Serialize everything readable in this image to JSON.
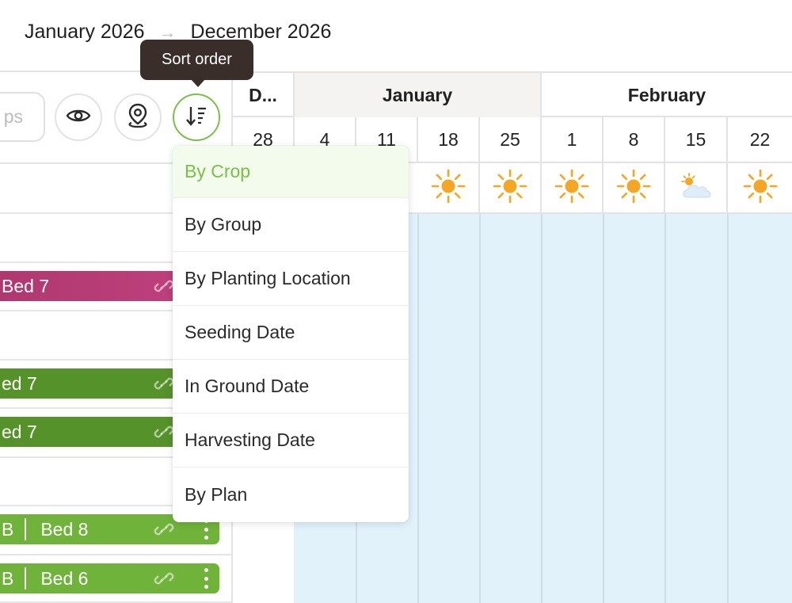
{
  "header": {
    "start_date": "January 2026",
    "arrow": "→",
    "end_date": "December 2026"
  },
  "tooltip": {
    "text": "Sort order"
  },
  "toolbar": {
    "search_placeholder_partial": "ps",
    "icons": [
      "eye-icon",
      "map-pin-icon",
      "sort-order-icon"
    ]
  },
  "rows": [
    {
      "label_partial": "Bed 7",
      "color": "#b83b78"
    },
    {
      "label_partial": "ed 7",
      "color": "#56922a"
    },
    {
      "label_partial": "ed 7",
      "color": "#56922a"
    },
    {
      "block_partial": "B",
      "label": "Bed 8",
      "color": "#6fb33a"
    },
    {
      "block_partial": "B",
      "label": "Bed 6",
      "color": "#6fb33a"
    }
  ],
  "calendar": {
    "months": [
      "D...",
      "January",
      "February"
    ],
    "weeks": [
      "28",
      "4",
      "11",
      "18",
      "25",
      "1",
      "8",
      "15",
      "22"
    ],
    "weather": [
      "",
      "",
      "",
      "sun",
      "sun",
      "sun",
      "sun",
      "cloud-sun",
      "sun"
    ]
  },
  "sort_menu": {
    "selected": "By Crop",
    "options": [
      "By Crop",
      "By Group",
      "By Planting Location",
      "Seeding Date",
      "In Ground Date",
      "Harvesting Date",
      "By Plan"
    ]
  },
  "colors": {
    "accent_green": "#7bbf4a",
    "tooltip_bg": "#3a2e2a",
    "calendar_bg": "#e1f2fb",
    "sun": "#f5a623"
  }
}
